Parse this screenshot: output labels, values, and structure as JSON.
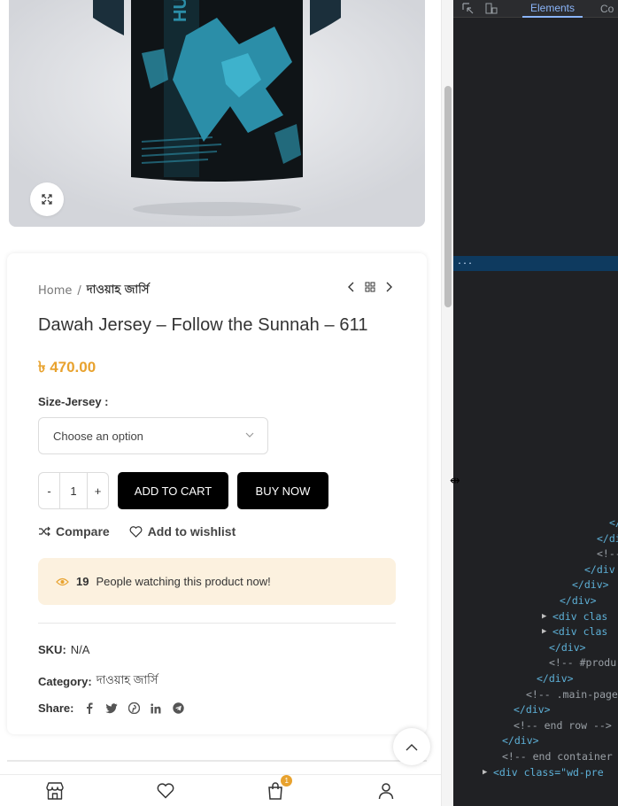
{
  "breadcrumb": {
    "home": "Home",
    "sep": "/",
    "current": "দাওয়াহ জার্সি"
  },
  "product": {
    "title": "Dawah Jersey – Follow the Sunnah – 611",
    "price": "৳ 470.00"
  },
  "variation": {
    "label": "Size-Jersey :",
    "select_value": "Choose an option"
  },
  "cart": {
    "minus": "-",
    "qty": "1",
    "plus": "+",
    "add_label": "ADD TO CART",
    "buy_label": "BUY NOW"
  },
  "actions": {
    "compare": "Compare",
    "wishlist": "Add to wishlist"
  },
  "watching": {
    "count": "19",
    "text": "People watching this product now!"
  },
  "meta": {
    "sku_label": "SKU:",
    "sku_value": "N/A",
    "cat_label": "Category:",
    "cat_value": "দাওয়াহ জার্সি",
    "share_label": "Share:"
  },
  "share_icons": [
    "facebook-icon",
    "twitter-icon",
    "pinterest-icon",
    "linkedin-icon",
    "telegram-icon"
  ],
  "bottom_nav": {
    "cart_badge": "1"
  },
  "colors": {
    "accent": "#e8a22e",
    "watch_bg": "#fcf1df",
    "devtools_bg": "#202124"
  },
  "devtools": {
    "tab_elements": "Elements",
    "tab_console": "Co",
    "selected_dots": "...",
    "lines": [
      {
        "text": "</",
        "cls": "tag"
      },
      {
        "text": "</di",
        "cls": "tag"
      },
      {
        "text": "<!--",
        "cls": "cmt"
      },
      {
        "text": "</div",
        "cls": "tag"
      },
      {
        "text": "</div>",
        "cls": "tag"
      },
      {
        "text": "</div>",
        "cls": "tag"
      },
      {
        "text": "<div clas",
        "cls": "tag"
      },
      {
        "text": "<div clas",
        "cls": "tag"
      },
      {
        "text": "</div>",
        "cls": "tag"
      },
      {
        "text": "<!-- #produ",
        "cls": "cmt"
      },
      {
        "text": "</div>",
        "cls": "tag"
      },
      {
        "text": "<!-- .main-page",
        "cls": "cmt"
      },
      {
        "text": "</div>",
        "cls": "tag"
      },
      {
        "text": "<!-- end row -->",
        "cls": "cmt"
      },
      {
        "text": "</div>",
        "cls": "tag"
      },
      {
        "text": "<!-- end container",
        "cls": "cmt"
      },
      {
        "text": "<div class=\"wd-pre",
        "cls": "tag"
      }
    ]
  }
}
